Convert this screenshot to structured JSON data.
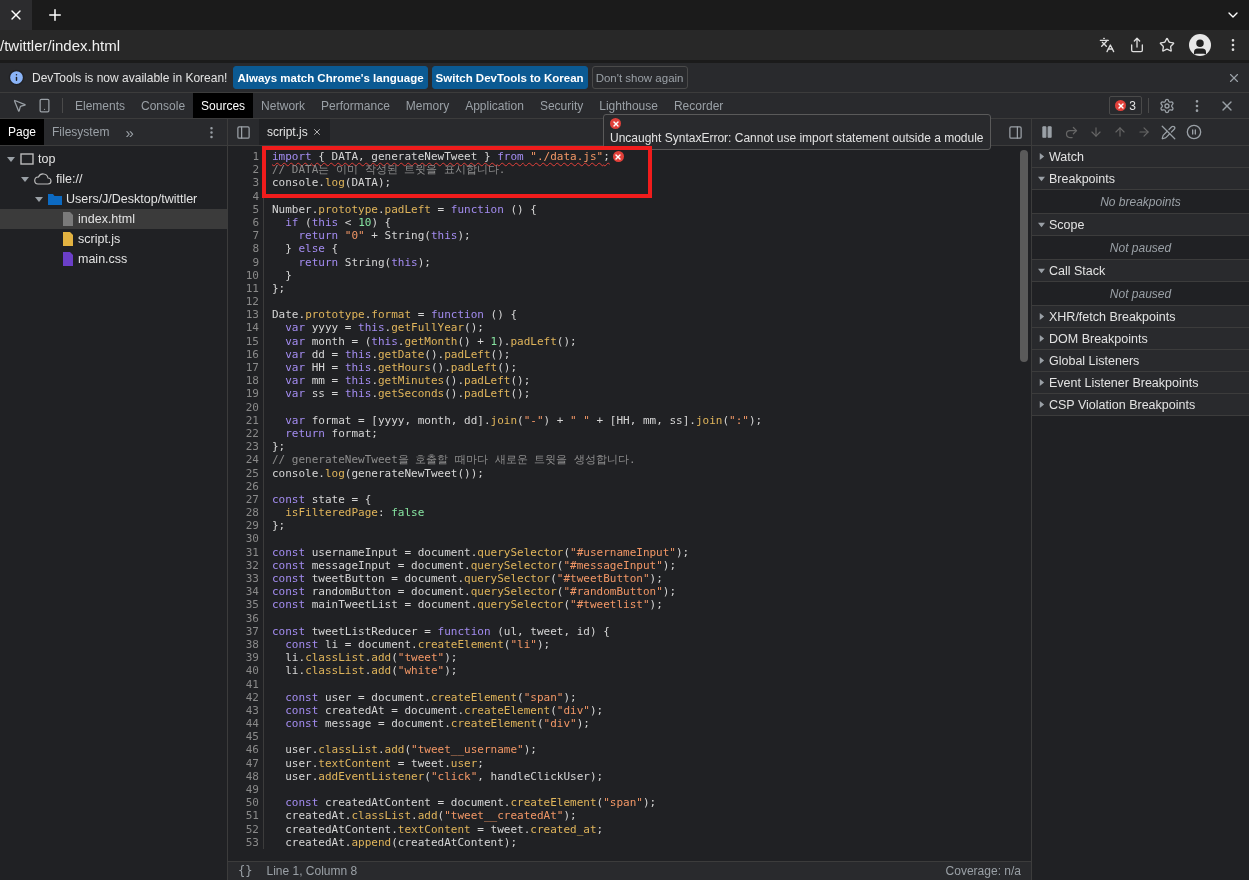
{
  "browser": {
    "url": "/twittler/index.html"
  },
  "infobar": {
    "message": "DevTools is now available in Korean!",
    "buttons": [
      {
        "label": "Always match Chrome's language",
        "kind": "primary"
      },
      {
        "label": "Switch DevTools to Korean",
        "kind": "primary"
      },
      {
        "label": "Don't show again",
        "kind": "secondary"
      }
    ]
  },
  "devtools_tabs": [
    {
      "label": "Elements",
      "selected": false
    },
    {
      "label": "Console",
      "selected": false
    },
    {
      "label": "Sources",
      "selected": true
    },
    {
      "label": "Network",
      "selected": false
    },
    {
      "label": "Performance",
      "selected": false
    },
    {
      "label": "Memory",
      "selected": false
    },
    {
      "label": "Application",
      "selected": false
    },
    {
      "label": "Security",
      "selected": false
    },
    {
      "label": "Lighthouse",
      "selected": false
    },
    {
      "label": "Recorder",
      "selected": false
    }
  ],
  "error_count": "3",
  "tooltip": "Uncaught SyntaxError: Cannot use import statement outside a module",
  "navigator": {
    "tabs": [
      {
        "label": "Page",
        "selected": true
      },
      {
        "label": "Filesystem",
        "selected": false
      }
    ],
    "more": "»",
    "tree": [
      {
        "label": "top",
        "kind": "frame",
        "expanded": true,
        "selected": false,
        "children": [
          {
            "label": "file://",
            "kind": "origin",
            "expanded": true,
            "selected": false,
            "children": [
              {
                "label": "Users/J/Desktop/twittler",
                "kind": "folder",
                "expanded": true,
                "selected": false,
                "children": [
                  {
                    "label": "index.html",
                    "kind": "file",
                    "color": "#7a7a7a",
                    "selected": true
                  },
                  {
                    "label": "script.js",
                    "kind": "file",
                    "color": "#e3b341",
                    "selected": false
                  },
                  {
                    "label": "main.css",
                    "kind": "file",
                    "color": "#6b3fc8",
                    "selected": false
                  }
                ]
              }
            ]
          }
        ]
      }
    ]
  },
  "editor": {
    "tab": "script.js",
    "lines": [
      {
        "no": "1",
        "error": true,
        "t": [
          {
            "kind": "k",
            "text": "import"
          },
          {
            "kind": "t",
            "text": " { DATA, generateNewTweet } "
          },
          {
            "kind": "k",
            "text": "from"
          },
          {
            "kind": "s",
            "text": " \"./data.js\""
          },
          {
            "kind": "t",
            "text": ";"
          }
        ]
      },
      {
        "no": "2",
        "t": [
          {
            "kind": "c",
            "text": "// DATA는 이미 작성된 트윗을 표시합니다."
          }
        ]
      },
      {
        "no": "3",
        "t": [
          {
            "kind": "t",
            "text": "console."
          },
          {
            "kind": "m",
            "text": "log"
          },
          {
            "kind": "t",
            "text": "(DATA);"
          }
        ]
      },
      {
        "no": "4"
      },
      {
        "no": "5",
        "t": [
          {
            "kind": "t",
            "text": "Number."
          },
          {
            "kind": "m",
            "text": "prototype"
          },
          {
            "kind": "t",
            "text": "."
          },
          {
            "kind": "m",
            "text": "padLeft"
          },
          {
            "kind": "t",
            "text": " = "
          },
          {
            "kind": "k",
            "text": "function"
          },
          {
            "kind": "t",
            "text": " () {"
          }
        ]
      },
      {
        "no": "6",
        "t": [
          {
            "kind": "k",
            "text": "  if"
          },
          {
            "kind": "t",
            "text": " ("
          },
          {
            "kind": "k",
            "text": "this"
          },
          {
            "kind": "t",
            "text": " < "
          },
          {
            "kind": "n",
            "text": "10"
          },
          {
            "kind": "t",
            "text": ") {"
          }
        ]
      },
      {
        "no": "7",
        "t": [
          {
            "kind": "k",
            "text": "    return"
          },
          {
            "kind": "s",
            "text": " \"0\""
          },
          {
            "kind": "t",
            "text": " + String("
          },
          {
            "kind": "k",
            "text": "this"
          },
          {
            "kind": "t",
            "text": ");"
          }
        ]
      },
      {
        "no": "8",
        "t": [
          {
            "kind": "t",
            "text": "  } "
          },
          {
            "kind": "k",
            "text": "else"
          },
          {
            "kind": "t",
            "text": " {"
          }
        ]
      },
      {
        "no": "9",
        "t": [
          {
            "kind": "k",
            "text": "    return"
          },
          {
            "kind": "t",
            "text": " String("
          },
          {
            "kind": "k",
            "text": "this"
          },
          {
            "kind": "t",
            "text": ");"
          }
        ]
      },
      {
        "no": "10",
        "t": [
          {
            "kind": "t",
            "text": "  }"
          }
        ]
      },
      {
        "no": "11",
        "t": [
          {
            "kind": "t",
            "text": "};"
          }
        ]
      },
      {
        "no": "12"
      },
      {
        "no": "13",
        "t": [
          {
            "kind": "t",
            "text": "Date."
          },
          {
            "kind": "m",
            "text": "prototype"
          },
          {
            "kind": "t",
            "text": "."
          },
          {
            "kind": "m",
            "text": "format"
          },
          {
            "kind": "t",
            "text": " = "
          },
          {
            "kind": "k",
            "text": "function"
          },
          {
            "kind": "t",
            "text": " () {"
          }
        ]
      },
      {
        "no": "14",
        "t": [
          {
            "kind": "k",
            "text": "  var"
          },
          {
            "kind": "t",
            "text": " yyyy = "
          },
          {
            "kind": "k",
            "text": "this"
          },
          {
            "kind": "t",
            "text": "."
          },
          {
            "kind": "m",
            "text": "getFullYear"
          },
          {
            "kind": "t",
            "text": "();"
          }
        ]
      },
      {
        "no": "15",
        "t": [
          {
            "kind": "k",
            "text": "  var"
          },
          {
            "kind": "t",
            "text": " month = ("
          },
          {
            "kind": "k",
            "text": "this"
          },
          {
            "kind": "t",
            "text": "."
          },
          {
            "kind": "m",
            "text": "getMonth"
          },
          {
            "kind": "t",
            "text": "() + "
          },
          {
            "kind": "n",
            "text": "1"
          },
          {
            "kind": "t",
            "text": ")."
          },
          {
            "kind": "m",
            "text": "padLeft"
          },
          {
            "kind": "t",
            "text": "();"
          }
        ]
      },
      {
        "no": "16",
        "t": [
          {
            "kind": "k",
            "text": "  var"
          },
          {
            "kind": "t",
            "text": " dd = "
          },
          {
            "kind": "k",
            "text": "this"
          },
          {
            "kind": "t",
            "text": "."
          },
          {
            "kind": "m",
            "text": "getDate"
          },
          {
            "kind": "t",
            "text": "()."
          },
          {
            "kind": "m",
            "text": "padLeft"
          },
          {
            "kind": "t",
            "text": "();"
          }
        ]
      },
      {
        "no": "17",
        "t": [
          {
            "kind": "k",
            "text": "  var"
          },
          {
            "kind": "t",
            "text": " HH = "
          },
          {
            "kind": "k",
            "text": "this"
          },
          {
            "kind": "t",
            "text": "."
          },
          {
            "kind": "m",
            "text": "getHours"
          },
          {
            "kind": "t",
            "text": "()."
          },
          {
            "kind": "m",
            "text": "padLeft"
          },
          {
            "kind": "t",
            "text": "();"
          }
        ]
      },
      {
        "no": "18",
        "t": [
          {
            "kind": "k",
            "text": "  var"
          },
          {
            "kind": "t",
            "text": " mm = "
          },
          {
            "kind": "k",
            "text": "this"
          },
          {
            "kind": "t",
            "text": "."
          },
          {
            "kind": "m",
            "text": "getMinutes"
          },
          {
            "kind": "t",
            "text": "()."
          },
          {
            "kind": "m",
            "text": "padLeft"
          },
          {
            "kind": "t",
            "text": "();"
          }
        ]
      },
      {
        "no": "19",
        "t": [
          {
            "kind": "k",
            "text": "  var"
          },
          {
            "kind": "t",
            "text": " ss = "
          },
          {
            "kind": "k",
            "text": "this"
          },
          {
            "kind": "t",
            "text": "."
          },
          {
            "kind": "m",
            "text": "getSeconds"
          },
          {
            "kind": "t",
            "text": "()."
          },
          {
            "kind": "m",
            "text": "padLeft"
          },
          {
            "kind": "t",
            "text": "();"
          }
        ]
      },
      {
        "no": "20"
      },
      {
        "no": "21",
        "t": [
          {
            "kind": "k",
            "text": "  var"
          },
          {
            "kind": "t",
            "text": " format = [yyyy, month, dd]."
          },
          {
            "kind": "m",
            "text": "join"
          },
          {
            "kind": "t",
            "text": "("
          },
          {
            "kind": "s",
            "text": "\"-\""
          },
          {
            "kind": "t",
            "text": ") + "
          },
          {
            "kind": "s",
            "text": "\" \""
          },
          {
            "kind": "t",
            "text": " + [HH, mm, ss]."
          },
          {
            "kind": "m",
            "text": "join"
          },
          {
            "kind": "t",
            "text": "("
          },
          {
            "kind": "s",
            "text": "\":\""
          },
          {
            "kind": "t",
            "text": ");"
          }
        ]
      },
      {
        "no": "22",
        "t": [
          {
            "kind": "k",
            "text": "  return"
          },
          {
            "kind": "t",
            "text": " format;"
          }
        ]
      },
      {
        "no": "23",
        "t": [
          {
            "kind": "t",
            "text": "};"
          }
        ]
      },
      {
        "no": "24",
        "t": [
          {
            "kind": "c",
            "text": "// generateNewTweet을 호출할 때마다 새로운 트윗을 생성합니다."
          }
        ]
      },
      {
        "no": "25",
        "t": [
          {
            "kind": "t",
            "text": "console."
          },
          {
            "kind": "m",
            "text": "log"
          },
          {
            "kind": "t",
            "text": "(generateNewTweet());"
          }
        ]
      },
      {
        "no": "26"
      },
      {
        "no": "27",
        "t": [
          {
            "kind": "k",
            "text": "const"
          },
          {
            "kind": "t",
            "text": " state = {"
          }
        ]
      },
      {
        "no": "28",
        "t": [
          {
            "kind": "m",
            "text": "  isFilteredPage"
          },
          {
            "kind": "t",
            "text": ": "
          },
          {
            "kind": "n",
            "text": "false"
          }
        ]
      },
      {
        "no": "29",
        "t": [
          {
            "kind": "t",
            "text": "};"
          }
        ]
      },
      {
        "no": "30"
      },
      {
        "no": "31",
        "t": [
          {
            "kind": "k",
            "text": "const"
          },
          {
            "kind": "t",
            "text": " usernameInput = document."
          },
          {
            "kind": "m",
            "text": "querySelector"
          },
          {
            "kind": "t",
            "text": "("
          },
          {
            "kind": "s",
            "text": "\"#usernameInput\""
          },
          {
            "kind": "t",
            "text": ");"
          }
        ]
      },
      {
        "no": "32",
        "t": [
          {
            "kind": "k",
            "text": "const"
          },
          {
            "kind": "t",
            "text": " messageInput = document."
          },
          {
            "kind": "m",
            "text": "querySelector"
          },
          {
            "kind": "t",
            "text": "("
          },
          {
            "kind": "s",
            "text": "\"#messageInput\""
          },
          {
            "kind": "t",
            "text": ");"
          }
        ]
      },
      {
        "no": "33",
        "t": [
          {
            "kind": "k",
            "text": "const"
          },
          {
            "kind": "t",
            "text": " tweetButton = document."
          },
          {
            "kind": "m",
            "text": "querySelector"
          },
          {
            "kind": "t",
            "text": "("
          },
          {
            "kind": "s",
            "text": "\"#tweetButton\""
          },
          {
            "kind": "t",
            "text": ");"
          }
        ]
      },
      {
        "no": "34",
        "t": [
          {
            "kind": "k",
            "text": "const"
          },
          {
            "kind": "t",
            "text": " randomButton = document."
          },
          {
            "kind": "m",
            "text": "querySelector"
          },
          {
            "kind": "t",
            "text": "("
          },
          {
            "kind": "s",
            "text": "\"#randomButton\""
          },
          {
            "kind": "t",
            "text": ");"
          }
        ]
      },
      {
        "no": "35",
        "t": [
          {
            "kind": "k",
            "text": "const"
          },
          {
            "kind": "t",
            "text": " mainTweetList = document."
          },
          {
            "kind": "m",
            "text": "querySelector"
          },
          {
            "kind": "t",
            "text": "("
          },
          {
            "kind": "s",
            "text": "\"#tweetlist\""
          },
          {
            "kind": "t",
            "text": ");"
          }
        ]
      },
      {
        "no": "36"
      },
      {
        "no": "37",
        "t": [
          {
            "kind": "k",
            "text": "const"
          },
          {
            "kind": "t",
            "text": " tweetListReducer = "
          },
          {
            "kind": "k",
            "text": "function"
          },
          {
            "kind": "t",
            "text": " (ul, tweet, id) {"
          }
        ]
      },
      {
        "no": "38",
        "t": [
          {
            "kind": "k",
            "text": "  const"
          },
          {
            "kind": "t",
            "text": " li = document."
          },
          {
            "kind": "m",
            "text": "createElement"
          },
          {
            "kind": "t",
            "text": "("
          },
          {
            "kind": "s",
            "text": "\"li\""
          },
          {
            "kind": "t",
            "text": ");"
          }
        ]
      },
      {
        "no": "39",
        "t": [
          {
            "kind": "t",
            "text": "  li."
          },
          {
            "kind": "m",
            "text": "classList"
          },
          {
            "kind": "t",
            "text": "."
          },
          {
            "kind": "m",
            "text": "add"
          },
          {
            "kind": "t",
            "text": "("
          },
          {
            "kind": "s",
            "text": "\"tweet\""
          },
          {
            "kind": "t",
            "text": ");"
          }
        ]
      },
      {
        "no": "40",
        "t": [
          {
            "kind": "t",
            "text": "  li."
          },
          {
            "kind": "m",
            "text": "classList"
          },
          {
            "kind": "t",
            "text": "."
          },
          {
            "kind": "m",
            "text": "add"
          },
          {
            "kind": "t",
            "text": "("
          },
          {
            "kind": "s",
            "text": "\"white\""
          },
          {
            "kind": "t",
            "text": ");"
          }
        ]
      },
      {
        "no": "41"
      },
      {
        "no": "42",
        "t": [
          {
            "kind": "k",
            "text": "  const"
          },
          {
            "kind": "t",
            "text": " user = document."
          },
          {
            "kind": "m",
            "text": "createElement"
          },
          {
            "kind": "t",
            "text": "("
          },
          {
            "kind": "s",
            "text": "\"span\""
          },
          {
            "kind": "t",
            "text": ");"
          }
        ]
      },
      {
        "no": "43",
        "t": [
          {
            "kind": "k",
            "text": "  const"
          },
          {
            "kind": "t",
            "text": " createdAt = document."
          },
          {
            "kind": "m",
            "text": "createElement"
          },
          {
            "kind": "t",
            "text": "("
          },
          {
            "kind": "s",
            "text": "\"div\""
          },
          {
            "kind": "t",
            "text": ");"
          }
        ]
      },
      {
        "no": "44",
        "t": [
          {
            "kind": "k",
            "text": "  const"
          },
          {
            "kind": "t",
            "text": " message = document."
          },
          {
            "kind": "m",
            "text": "createElement"
          },
          {
            "kind": "t",
            "text": "("
          },
          {
            "kind": "s",
            "text": "\"div\""
          },
          {
            "kind": "t",
            "text": ");"
          }
        ]
      },
      {
        "no": "45"
      },
      {
        "no": "46",
        "t": [
          {
            "kind": "t",
            "text": "  user."
          },
          {
            "kind": "m",
            "text": "classList"
          },
          {
            "kind": "t",
            "text": "."
          },
          {
            "kind": "m",
            "text": "add"
          },
          {
            "kind": "t",
            "text": "("
          },
          {
            "kind": "s",
            "text": "\"tweet__username\""
          },
          {
            "kind": "t",
            "text": ");"
          }
        ]
      },
      {
        "no": "47",
        "t": [
          {
            "kind": "t",
            "text": "  user."
          },
          {
            "kind": "m",
            "text": "textContent"
          },
          {
            "kind": "t",
            "text": " = tweet."
          },
          {
            "kind": "m",
            "text": "user"
          },
          {
            "kind": "t",
            "text": ";"
          }
        ]
      },
      {
        "no": "48",
        "t": [
          {
            "kind": "t",
            "text": "  user."
          },
          {
            "kind": "m",
            "text": "addEventListener"
          },
          {
            "kind": "t",
            "text": "("
          },
          {
            "kind": "s",
            "text": "\"click\""
          },
          {
            "kind": "t",
            "text": ", handleClickUser);"
          }
        ]
      },
      {
        "no": "49"
      },
      {
        "no": "50",
        "t": [
          {
            "kind": "k",
            "text": "  const"
          },
          {
            "kind": "t",
            "text": " createdAtContent = document."
          },
          {
            "kind": "m",
            "text": "createElement"
          },
          {
            "kind": "t",
            "text": "("
          },
          {
            "kind": "s",
            "text": "\"span\""
          },
          {
            "kind": "t",
            "text": ");"
          }
        ]
      },
      {
        "no": "51",
        "t": [
          {
            "kind": "t",
            "text": "  createdAt."
          },
          {
            "kind": "m",
            "text": "classList"
          },
          {
            "kind": "t",
            "text": "."
          },
          {
            "kind": "m",
            "text": "add"
          },
          {
            "kind": "t",
            "text": "("
          },
          {
            "kind": "s",
            "text": "\"tweet__createdAt\""
          },
          {
            "kind": "t",
            "text": ");"
          }
        ]
      },
      {
        "no": "52",
        "t": [
          {
            "kind": "t",
            "text": "  createdAtContent."
          },
          {
            "kind": "m",
            "text": "textContent"
          },
          {
            "kind": "t",
            "text": " = tweet."
          },
          {
            "kind": "m",
            "text": "created_at"
          },
          {
            "kind": "t",
            "text": ";"
          }
        ]
      },
      {
        "no": "53",
        "t": [
          {
            "kind": "t",
            "text": "  createdAt."
          },
          {
            "kind": "m",
            "text": "append"
          },
          {
            "kind": "t",
            "text": "(createdAtContent);"
          }
        ]
      }
    ]
  },
  "status_bar": {
    "format_glyph": "{}",
    "position": "Line 1, Column 8",
    "coverage": "Coverage: n/a"
  },
  "debugger": {
    "sections": [
      {
        "title": "Watch",
        "expanded": false
      },
      {
        "title": "Breakpoints",
        "expanded": true,
        "body": "No breakpoints"
      },
      {
        "title": "Scope",
        "expanded": true,
        "body": "Not paused"
      },
      {
        "title": "Call Stack",
        "expanded": true,
        "body": "Not paused"
      },
      {
        "title": "XHR/fetch Breakpoints",
        "expanded": false
      },
      {
        "title": "DOM Breakpoints",
        "expanded": false
      },
      {
        "title": "Global Listeners",
        "expanded": false
      },
      {
        "title": "Event Listener Breakpoints",
        "expanded": false
      },
      {
        "title": "CSP Violation Breakpoints",
        "expanded": false
      }
    ]
  }
}
